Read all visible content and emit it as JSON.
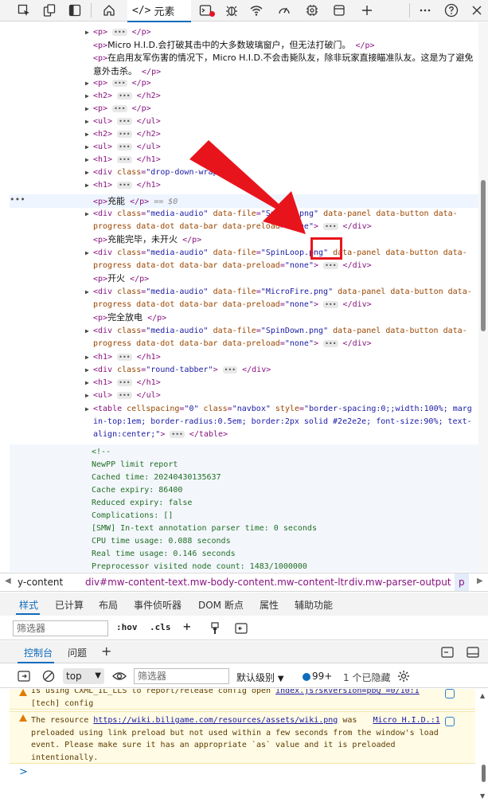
{
  "toolbar": {
    "elements_tab_label": "元素",
    "icons": [
      "inspect-icon",
      "device-emulation-icon",
      "dock-sidebar-icon",
      "welcome-home-icon",
      "elements-code-icon",
      "console-icon",
      "sources-bug-icon",
      "network-wifi-icon",
      "performance-gauge-icon",
      "memory-chip-icon",
      "application-panel-icon",
      "add-tool-icon",
      "more-options-icon",
      "help-icon",
      "close-icon"
    ],
    "error_badge_color": "#e81123"
  },
  "dom": {
    "lines": {
      "l1_p": "<p>",
      "l1_end": "</p>",
      "l2_text": "Micro H.I.D.会打破其击中的大多数玻璃窗户，但无法打破门。",
      "l3_text": "在启用友军伤害的情况下，Micro H.I.D.不会击毙队友，除非玩家直接瞄准队友。这是为了避免意外击杀。",
      "h2_open": "<h2>",
      "h2_close": "</h2>",
      "ul_open": "<ul>",
      "ul_close": "</ul>",
      "h1_open": "<h1>",
      "h1_close": "</h1>",
      "p_open": "<p>",
      "p_close": "</p>",
      "div_dropdown_class": "drop-down-wrap",
      "selected_text": "充能",
      "selected_marker": "== $0",
      "media1_file": "SpinUp.png",
      "media_attrs": "data-panel data-button data-progress data-dot data-bar data-preload",
      "media_preload_value": "none",
      "p_text_2": "充能完毕，未开火",
      "media2_file": "SpinLoop.png",
      "p_text_3": "开火",
      "media3_file": "MicroFire.png",
      "p_text_4": "完全放电",
      "media4_file": "SpinDown.png",
      "round_tabber_class": "round-tabber",
      "table_cellspacing": "0",
      "table_class": "navbox",
      "table_style": "border-spacing:0;;width:100%; margin-top:1em; border-radius:0.5em; border:2px solid #2e2e2e; font-size:90%; text-align:center;"
    },
    "comments": [
      "<!--",
      "NewPP limit report",
      "Cached time: 20240430135637",
      "Cache expiry: 86400",
      "Reduced expiry: false",
      "Complications: []",
      "[SMW] In‐text annotation parser time: 0 seconds",
      "CPU time usage: 0.088 seconds",
      "Real time usage: 0.146 seconds",
      "Preprocessor visited node count: 1483/1000000"
    ]
  },
  "breadcrumb": {
    "items": [
      "y-content",
      "div#mw-content-text.mw-body-content.mw-content-ltr",
      "div.mw-parser-output",
      "p"
    ]
  },
  "styles_tabs": [
    "样式",
    "已计算",
    "布局",
    "事件侦听器",
    "DOM 断点",
    "属性",
    "辅助功能"
  ],
  "styles_filter": {
    "placeholder": "筛选器",
    "hov": ":hov",
    "cls": ".cls"
  },
  "drawer_tabs": [
    "控制台",
    "问题"
  ],
  "console_toolbar": {
    "context": "top",
    "filter_placeholder": "筛选器",
    "level": "默认级别",
    "issues_count": "99+",
    "hidden": "1 个已隐藏"
  },
  "console": {
    "msg1_line1": "Is using CXML_IL_LLS to report/release config open",
    "msg1_link": "index.js?skversion=pbQ =0/10:1",
    "msg1_line2": "[tech] config",
    "msg2_prefix": "The resource",
    "msg2_url": "https://wiki.biligame.com/resources/assets/wiki.png",
    "msg2_was": "was",
    "msg2_source": "Micro H.I.D.:1",
    "msg2_line2": "preloaded using link preload but not used within a few seconds from the window's load",
    "msg2_line3": "event. Please make sure it has an appropriate `as` value and it is preloaded",
    "msg2_line4": "intentionally.",
    "prompt": ">"
  },
  "colors": {
    "accent": "#0f6cbd",
    "annotation_red": "#e8141c",
    "tag": "#881280",
    "attr_name": "#994500",
    "attr_value": "#1a1aa6",
    "comment": "#236e25"
  }
}
